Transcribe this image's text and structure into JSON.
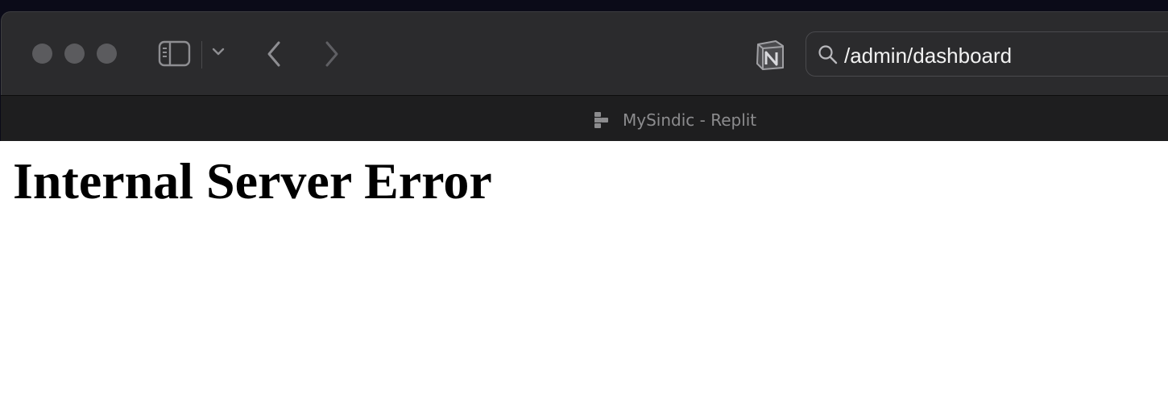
{
  "browser": {
    "address_bar": {
      "url": "/admin/dashboard"
    },
    "tab": {
      "title": "MySindic - Replit",
      "favicon": "replit-icon"
    },
    "toolbar_icons": [
      "sidebar-toggle-icon",
      "chevron-down-icon",
      "back-arrow-icon",
      "forward-arrow-icon",
      "notion-icon",
      "search-icon"
    ]
  },
  "page": {
    "heading": "Internal Server Error"
  },
  "colors": {
    "toolbar_bg": "#2b2b2d",
    "tabbar_bg": "#1e1e1f",
    "outer_bg": "#0b0b18",
    "page_bg": "#ffffff",
    "heading_color": "#000000"
  }
}
